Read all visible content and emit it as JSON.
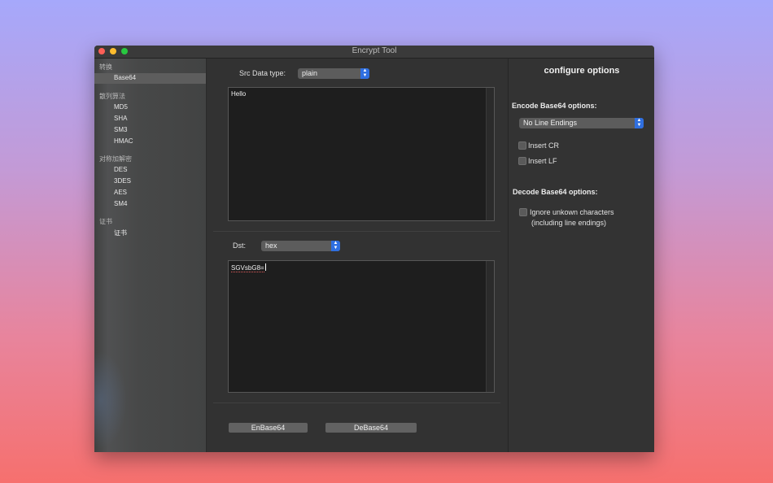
{
  "window": {
    "title": "Encrypt Tool"
  },
  "sidebar": {
    "groups": [
      {
        "label": "转换",
        "items": [
          "Base64"
        ]
      },
      {
        "label": "散列算法",
        "items": [
          "MD5",
          "SHA",
          "SM3",
          "HMAC"
        ]
      },
      {
        "label": "对称加解密",
        "items": [
          "DES",
          "3DES",
          "AES",
          "SM4"
        ]
      },
      {
        "label": "证书",
        "items": [
          "证书"
        ]
      }
    ],
    "selected": "Base64"
  },
  "main": {
    "src_label": "Src Data type:",
    "src_type": "plain",
    "src_text": "Hello",
    "dst_label": "Dst:",
    "dst_type": "hex",
    "dst_text": "SGVsbG8=",
    "encode_button": "EnBase64",
    "decode_button": "DeBase64"
  },
  "options": {
    "title": "configure options",
    "encode_heading": "Encode Base64 options:",
    "line_endings": "No Line Endings",
    "insert_cr": "Insert CR",
    "insert_lf": "Insert LF",
    "decode_heading": "Decode Base64 options:",
    "ignore_line1": "Ignore unkown characters",
    "ignore_line2": "(including line endings)"
  },
  "colors": {
    "accent": "#2f6fe0"
  }
}
